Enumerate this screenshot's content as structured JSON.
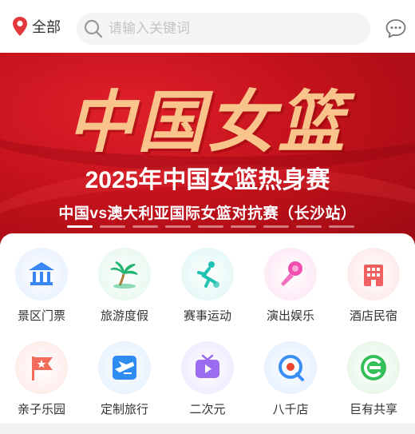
{
  "header": {
    "location_label": "全部",
    "search_placeholder": "请输入关键词"
  },
  "banner": {
    "title": "中国女篮",
    "subtitle": "2025年中国女篮热身赛",
    "subtitle2": "中国vs澳大利亚国际女篮对抗赛（长沙站）",
    "slide_count": 9,
    "active_slide": 1
  },
  "categories": [
    {
      "label": "景区门票",
      "icon": "temple-icon",
      "color": "#3a86f5"
    },
    {
      "label": "旅游度假",
      "icon": "palm-tree-icon",
      "color": "#22b573"
    },
    {
      "label": "赛事运动",
      "icon": "soccer-player-icon",
      "color": "#1fc2b0"
    },
    {
      "label": "演出娱乐",
      "icon": "microphone-icon",
      "color": "#f04fb0"
    },
    {
      "label": "酒店民宿",
      "icon": "hotel-icon",
      "color": "#f06060"
    },
    {
      "label": "亲子乐园",
      "icon": "flag-star-icon",
      "color": "#f26b5b"
    },
    {
      "label": "定制旅行",
      "icon": "airplane-icon",
      "color": "#2d8cf0"
    },
    {
      "label": "二次元",
      "icon": "tv-play-icon",
      "color": "#9a6cf0"
    },
    {
      "label": "八千店",
      "icon": "magnifier-icon",
      "color": "#3a8ff5"
    },
    {
      "label": "巨有共享",
      "icon": "share-logo-icon",
      "color": "#34c15a"
    }
  ]
}
